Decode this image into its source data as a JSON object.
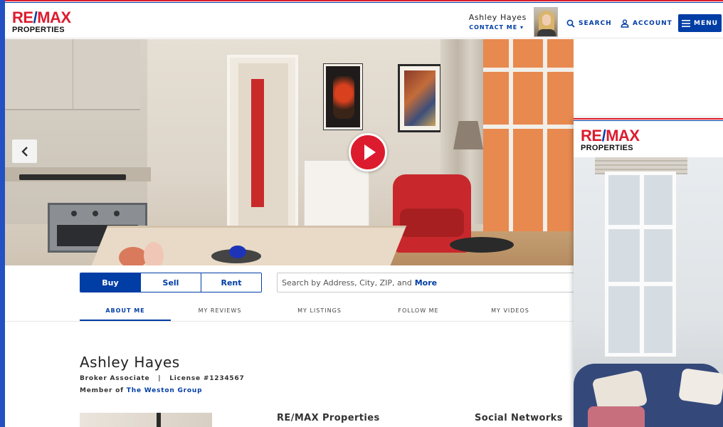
{
  "brand": {
    "logo_main_a": "RE",
    "logo_main_slash": "/",
    "logo_main_b": "MAX",
    "logo_sub": "PROPERTIES",
    "primary_color": "#003da5",
    "accent_color": "#dc1c2e"
  },
  "header": {
    "agent_name": "Ashley Hayes",
    "contact_label": "CONTACT ME",
    "search_label": "SEARCH",
    "account_label": "ACCOUNT",
    "menu_label": "MENU"
  },
  "hero": {
    "prev_icon": "chevron-left-icon",
    "play_icon": "play-icon"
  },
  "search": {
    "tabs": [
      "Buy",
      "Sell",
      "Rent"
    ],
    "active_tab": "Buy",
    "placeholder": "Search by Address, City, ZIP, and",
    "placeholder_more": "More"
  },
  "profile_tabs": [
    "ABOUT ME",
    "MY REVIEWS",
    "MY LISTINGS",
    "FOLLOW ME",
    "MY VIDEOS"
  ],
  "profile": {
    "name": "Ashley Hayes",
    "title": "Broker Associate",
    "separator": "|",
    "license": "License #1234567",
    "member_prefix": "Member of",
    "group": "The Weston Group"
  },
  "sections": {
    "office": "RE/MAX Properties",
    "social": "Social Networks"
  }
}
